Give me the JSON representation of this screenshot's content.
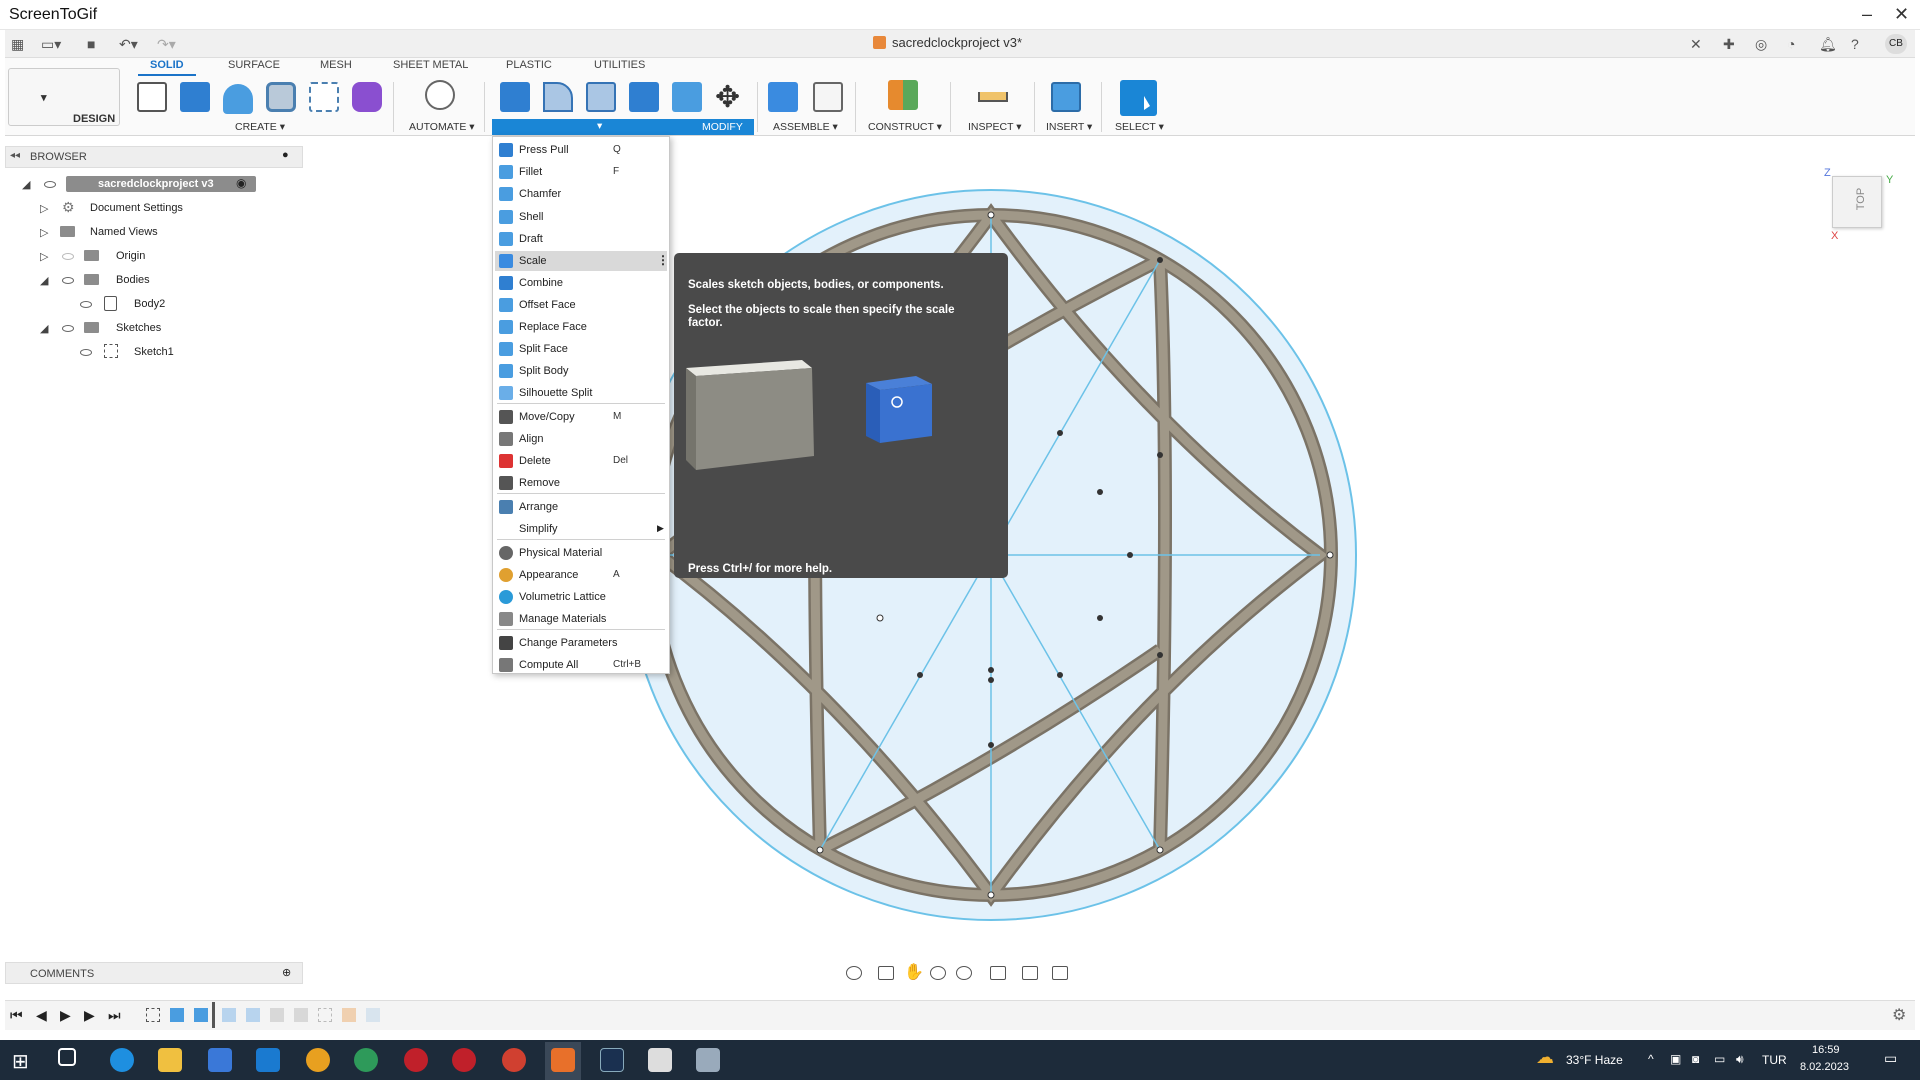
{
  "app": {
    "title": "ScreenToGif"
  },
  "fusion": {
    "document_title": "sacredclockproject v3*",
    "user_initials": "CB"
  },
  "ribbon": {
    "tabs": [
      "SOLID",
      "SURFACE",
      "MESH",
      "SHEET METAL",
      "PLASTIC",
      "UTILITIES"
    ],
    "workspace": "DESIGN",
    "groups": {
      "create": "CREATE",
      "automate": "AUTOMATE",
      "modify": "MODIFY",
      "assemble": "ASSEMBLE",
      "construct": "CONSTRUCT",
      "inspect": "INSPECT",
      "insert": "INSERT",
      "select": "SELECT"
    }
  },
  "browser": {
    "title": "BROWSER",
    "root": "sacredclockproject v3",
    "nodes": [
      "Document Settings",
      "Named Views",
      "Origin",
      "Bodies",
      "Body2",
      "Sketches",
      "Sketch1"
    ]
  },
  "modify_menu": {
    "items": [
      {
        "label": "Press Pull",
        "shortcut": "Q",
        "icon": "press-pull-icon"
      },
      {
        "label": "Fillet",
        "shortcut": "F",
        "icon": "fillet-icon"
      },
      {
        "label": "Chamfer",
        "shortcut": "",
        "icon": "chamfer-icon"
      },
      {
        "label": "Shell",
        "shortcut": "",
        "icon": "shell-icon"
      },
      {
        "label": "Draft",
        "shortcut": "",
        "icon": "draft-icon"
      },
      {
        "label": "Scale",
        "shortcut": "",
        "icon": "scale-icon"
      },
      {
        "label": "Combine",
        "shortcut": "",
        "icon": "combine-icon"
      },
      {
        "label": "Offset Face",
        "shortcut": "",
        "icon": "offset-face-icon"
      },
      {
        "label": "Replace Face",
        "shortcut": "",
        "icon": "replace-face-icon"
      },
      {
        "label": "Split Face",
        "shortcut": "",
        "icon": "split-face-icon"
      },
      {
        "label": "Split Body",
        "shortcut": "",
        "icon": "split-body-icon"
      },
      {
        "label": "Silhouette Split",
        "shortcut": "",
        "icon": "silhouette-split-icon"
      },
      {
        "label": "Move/Copy",
        "shortcut": "M",
        "icon": "move-icon"
      },
      {
        "label": "Align",
        "shortcut": "",
        "icon": "align-icon"
      },
      {
        "label": "Delete",
        "shortcut": "Del",
        "icon": "delete-icon"
      },
      {
        "label": "Remove",
        "shortcut": "",
        "icon": "remove-icon"
      },
      {
        "label": "Arrange",
        "shortcut": "",
        "icon": "arrange-icon"
      },
      {
        "label": "Simplify",
        "shortcut": "",
        "icon": "simplify-icon"
      },
      {
        "label": "Physical Material",
        "shortcut": "",
        "icon": "physical-material-icon"
      },
      {
        "label": "Appearance",
        "shortcut": "A",
        "icon": "appearance-icon"
      },
      {
        "label": "Volumetric Lattice",
        "shortcut": "",
        "icon": "volumetric-lattice-icon"
      },
      {
        "label": "Manage Materials",
        "shortcut": "",
        "icon": "manage-materials-icon"
      },
      {
        "label": "Change Parameters",
        "shortcut": "",
        "icon": "change-parameters-icon"
      },
      {
        "label": "Compute All",
        "shortcut": "Ctrl+B",
        "icon": "compute-all-icon"
      }
    ]
  },
  "tooltip": {
    "title": "Scales sketch objects, bodies, or components.",
    "body": "Select the objects to scale then specify the scale factor.",
    "footer": "Press Ctrl+/ for more help."
  },
  "viewcube": {
    "face": "TOP",
    "axis_z": "Z",
    "axis_y": "Y",
    "axis_x": "X"
  },
  "comments": {
    "title": "COMMENTS"
  },
  "taskbar": {
    "weather": "33°F  Haze",
    "language": "TUR",
    "time": "16:59",
    "date": "8.02.2023"
  },
  "colors": {
    "accent": "#1a86d6",
    "taskbar": "#1d2b3a",
    "body": "#8a8275",
    "sketch": "#5bb8e0"
  }
}
